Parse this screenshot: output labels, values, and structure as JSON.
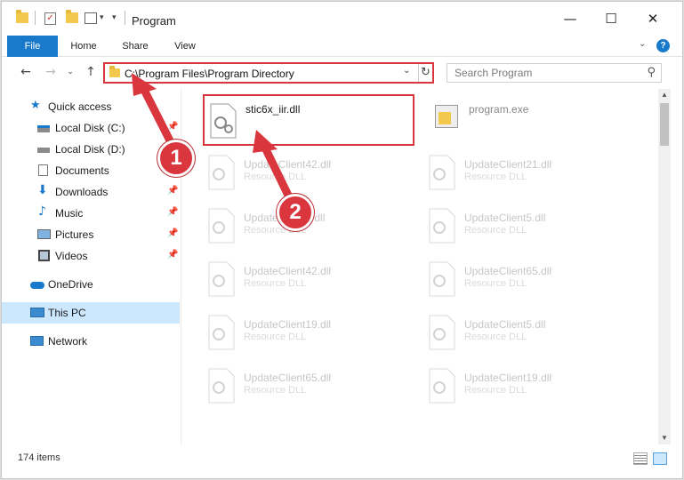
{
  "window": {
    "title": "Program",
    "controls": {
      "minimize": "—",
      "maximize": "☐",
      "close": "✕"
    }
  },
  "ribbon": {
    "tabs": [
      "File",
      "Home",
      "Share",
      "View"
    ],
    "help": "?"
  },
  "address_bar": {
    "path": "C:\\Program Files\\Program Directory"
  },
  "search": {
    "placeholder": "Search Program"
  },
  "navigation": {
    "items": [
      {
        "label": "Quick access",
        "icon": "star-icon",
        "pinned": false
      },
      {
        "label": "Local Disk (C:)",
        "icon": "drive-icon",
        "pinned": true
      },
      {
        "label": "Local Disk (D:)",
        "icon": "drive-icon",
        "pinned": true
      },
      {
        "label": "Documents",
        "icon": "documents-icon",
        "pinned": true
      },
      {
        "label": "Downloads",
        "icon": "download-icon",
        "pinned": true
      },
      {
        "label": "Music",
        "icon": "music-icon",
        "pinned": true
      },
      {
        "label": "Pictures",
        "icon": "pictures-icon",
        "pinned": true
      },
      {
        "label": "Videos",
        "icon": "videos-icon",
        "pinned": true
      },
      {
        "label": "OneDrive",
        "icon": "cloud-icon",
        "pinned": false
      },
      {
        "label": "This PC",
        "icon": "computer-icon",
        "pinned": false,
        "selected": true
      },
      {
        "label": "Network",
        "icon": "network-icon",
        "pinned": false
      }
    ]
  },
  "files": [
    {
      "name": "stic6x_iir.dll",
      "type": ""
    },
    {
      "name": "program.exe",
      "type": ""
    },
    {
      "name": "UpdateClient42.dll",
      "type": "Resource DLL"
    },
    {
      "name": "UpdateClient21.dll",
      "type": "Resource DLL"
    },
    {
      "name": "UpdateClient5.dll",
      "type": "Resource DLL"
    },
    {
      "name": "UpdateClient5.dll",
      "type": "Resource DLL"
    },
    {
      "name": "UpdateClient42.dll",
      "type": "Resource DLL"
    },
    {
      "name": "UpdateClient65.dll",
      "type": "Resource DLL"
    },
    {
      "name": "UpdateClient19.dll",
      "type": "Resource DLL"
    },
    {
      "name": "UpdateClient5.dll",
      "type": "Resource DLL"
    },
    {
      "name": "UpdateClient65.dll",
      "type": "Resource DLL"
    },
    {
      "name": "UpdateClient19.dll",
      "type": "Resource DLL"
    }
  ],
  "status": {
    "item_count": "174 items"
  },
  "annotations": {
    "badge_1": "1",
    "badge_2": "2",
    "highlight_color": "#d9363e"
  }
}
